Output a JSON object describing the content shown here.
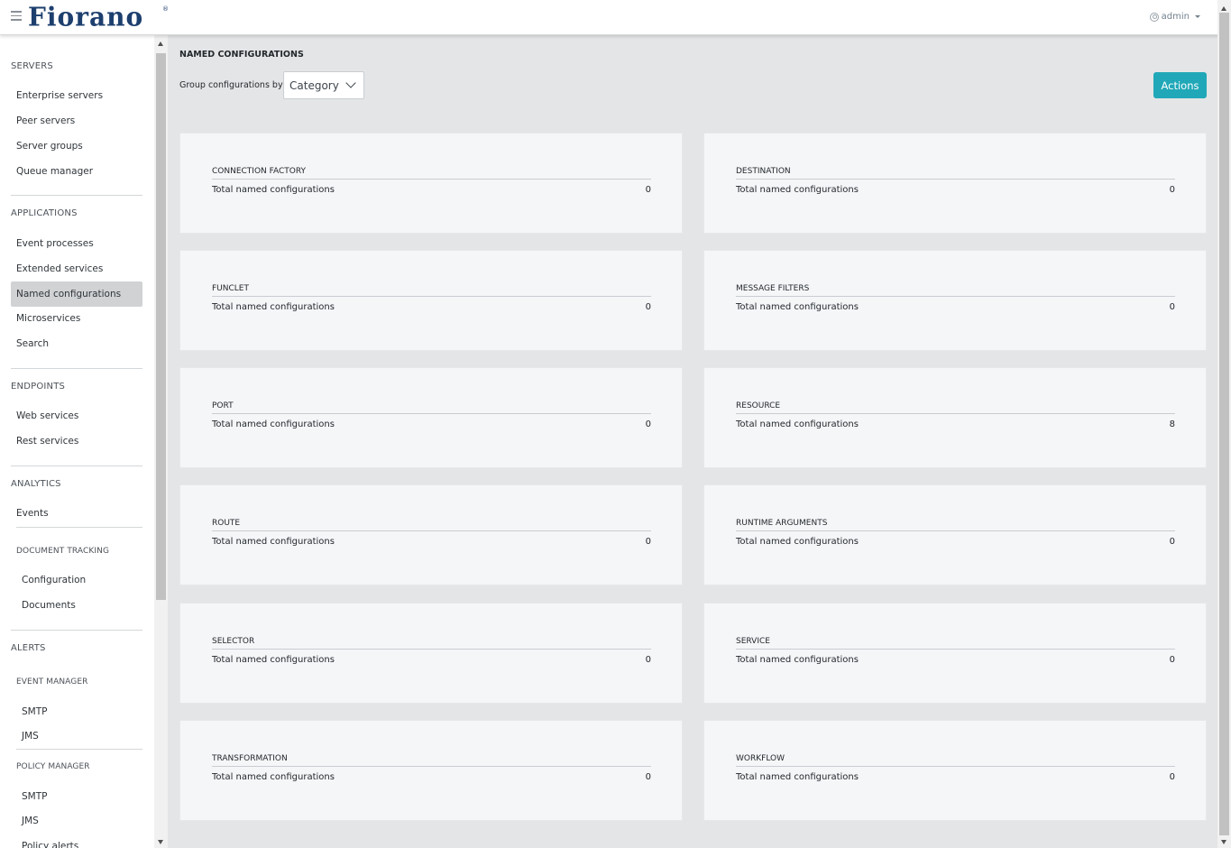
{
  "header": {
    "logo_text": "Fiorano",
    "user_label": "admin"
  },
  "sidebar": {
    "sections": {
      "servers": "SERVERS",
      "applications": "APPLICATIONS",
      "endpoints": "ENDPOINTS",
      "analytics": "ANALYTICS",
      "document_tracking": "DOCUMENT TRACKING",
      "alerts": "ALERTS",
      "event_manager": "EVENT MANAGER",
      "policy_manager": "POLICY MANAGER"
    },
    "items": {
      "enterprise_servers": "Enterprise servers",
      "peer_servers": "Peer servers",
      "server_groups": "Server groups",
      "queue_manager": "Queue manager",
      "event_processes": "Event processes",
      "extended_services": "Extended services",
      "named_configurations": "Named configurations",
      "microservices": "Microservices",
      "search": "Search",
      "web_services": "Web services",
      "rest_services": "Rest services",
      "events": "Events",
      "configuration": "Configuration",
      "documents": "Documents",
      "event_smtp": "SMTP",
      "event_jms": "JMS",
      "policy_smtp": "SMTP",
      "policy_jms": "JMS",
      "policy_alerts": "Policy alerts"
    },
    "active_item": "Named configurations"
  },
  "main": {
    "title": "NAMED CONFIGURATIONS",
    "group_label": "Group configurations by",
    "group_select_value": "Category",
    "actions_label": "Actions",
    "cards": [
      {
        "title": "CONNECTION FACTORY",
        "label": "Total named configurations",
        "value": "0"
      },
      {
        "title": "DESTINATION",
        "label": "Total named configurations",
        "value": "0"
      },
      {
        "title": "FUNCLET",
        "label": "Total named configurations",
        "value": "0"
      },
      {
        "title": "MESSAGE FILTERS",
        "label": "Total named configurations",
        "value": "0"
      },
      {
        "title": "PORT",
        "label": "Total named configurations",
        "value": "0"
      },
      {
        "title": "RESOURCE",
        "label": "Total named configurations",
        "value": "8"
      },
      {
        "title": "ROUTE",
        "label": "Total named configurations",
        "value": "0"
      },
      {
        "title": "RUNTIME ARGUMENTS",
        "label": "Total named configurations",
        "value": "0"
      },
      {
        "title": "SELECTOR",
        "label": "Total named configurations",
        "value": "0"
      },
      {
        "title": "SERVICE",
        "label": "Total named configurations",
        "value": "0"
      },
      {
        "title": "TRANSFORMATION",
        "label": "Total named configurations",
        "value": "0"
      },
      {
        "title": "WORKFLOW",
        "label": "Total named configurations",
        "value": "0"
      }
    ]
  }
}
